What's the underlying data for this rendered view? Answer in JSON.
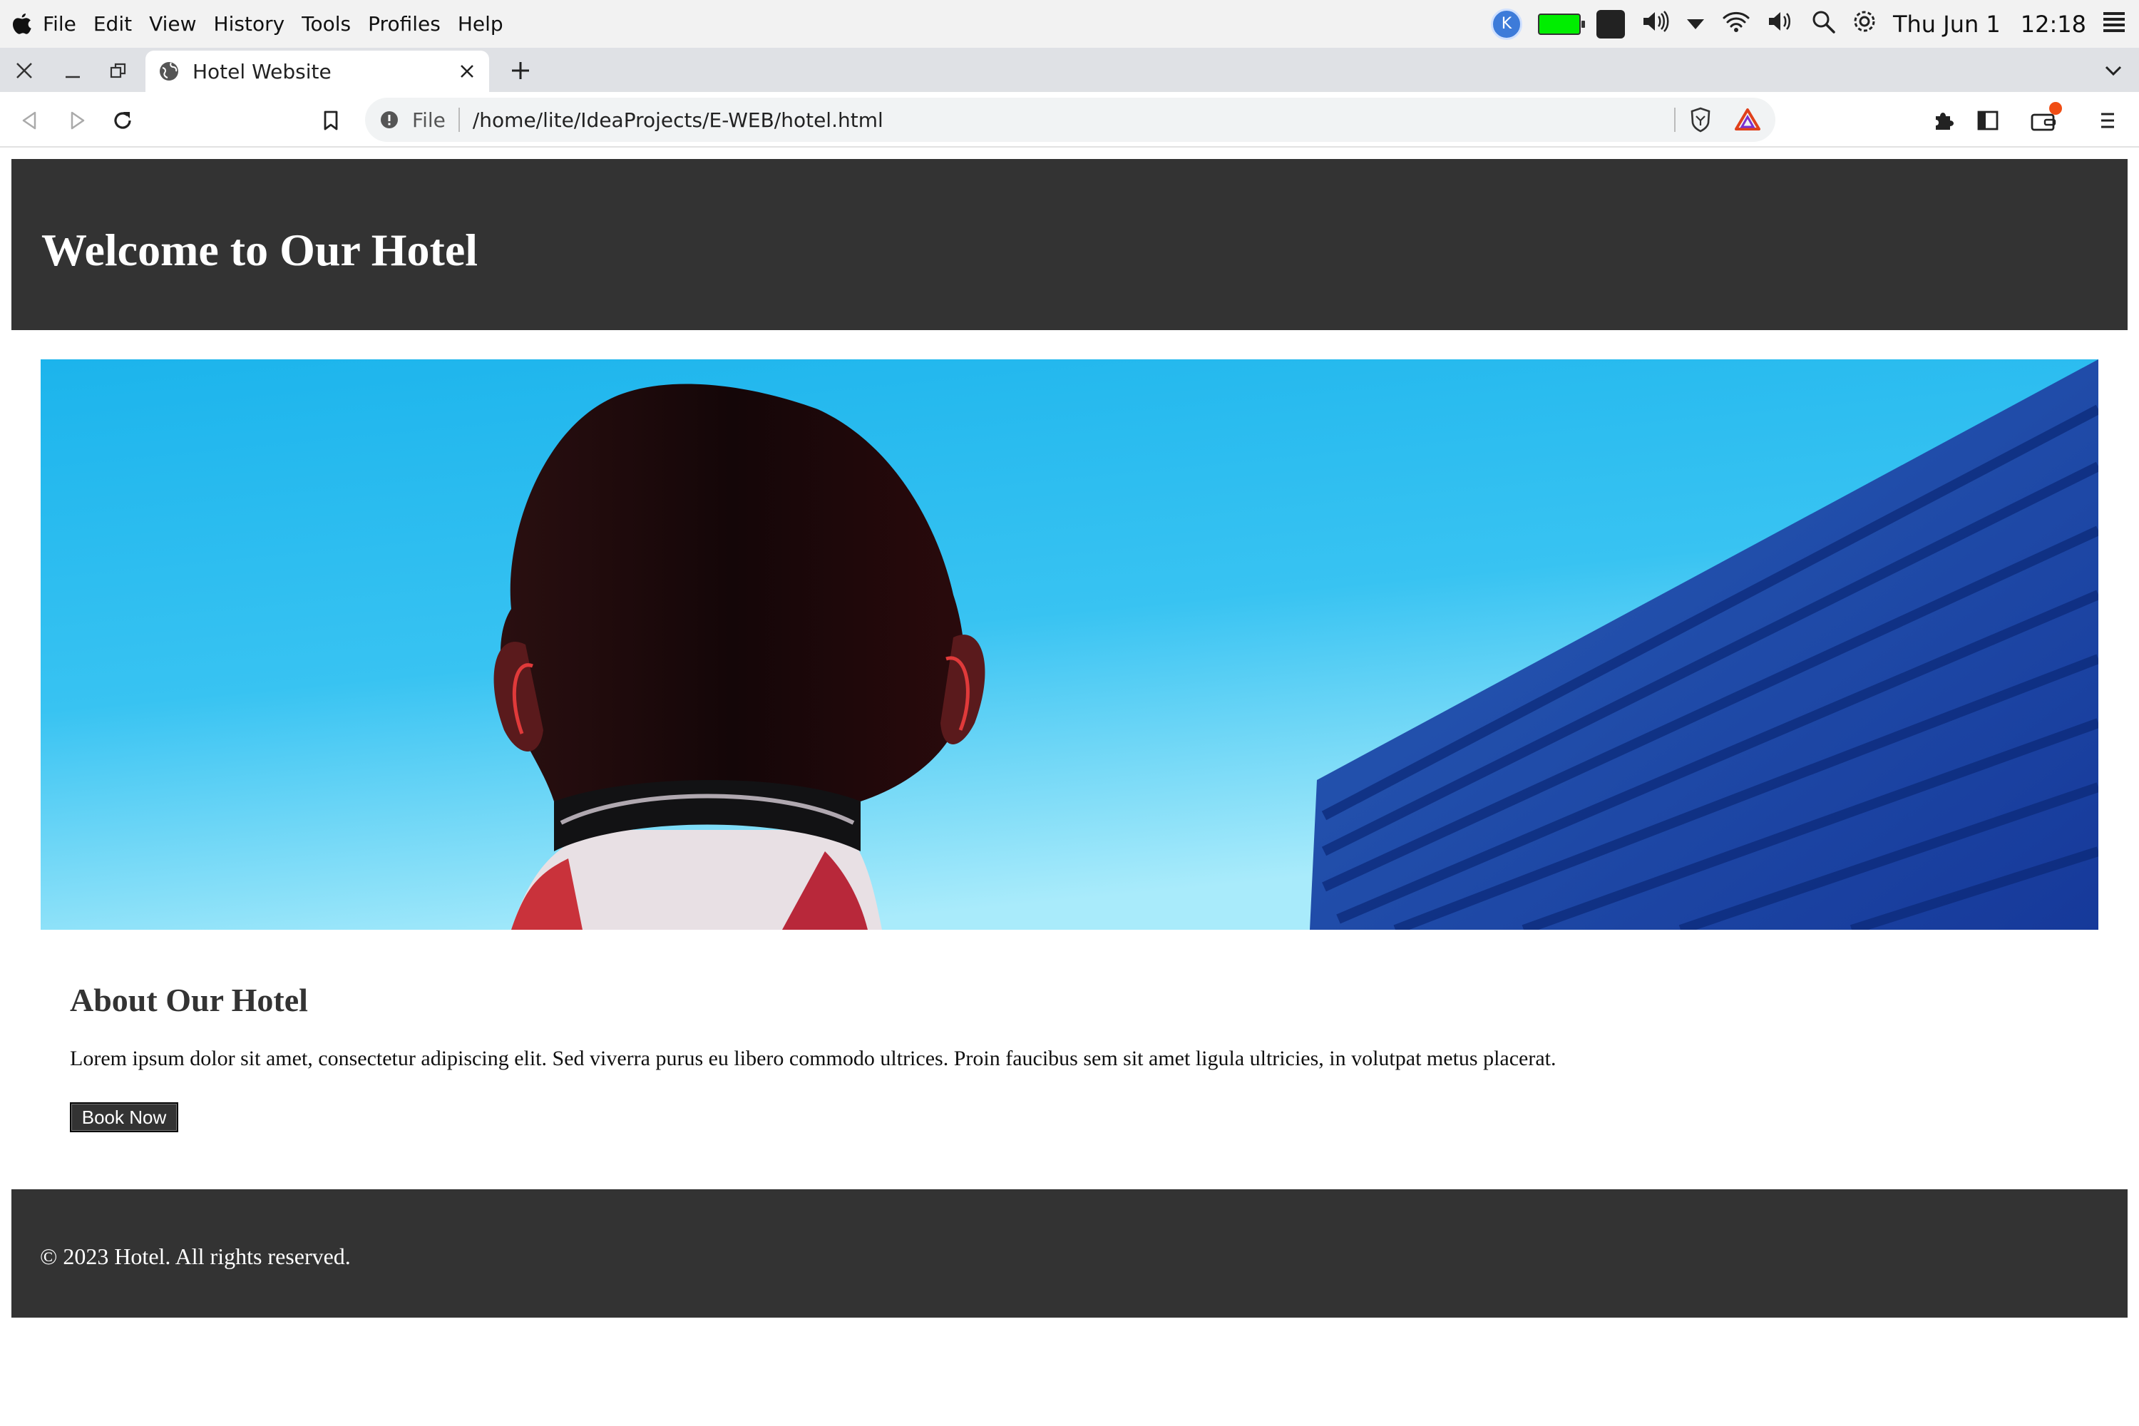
{
  "menubar": {
    "items": [
      "File",
      "Edit",
      "View",
      "History",
      "Tools",
      "Profiles",
      "Help"
    ],
    "date": "Thu Jun 1",
    "time": "12:18"
  },
  "browser": {
    "tab_title": "Hotel Website",
    "url_scheme": "File",
    "url_path": "/home/lite/IdeaProjects/E-WEB/hotel.html"
  },
  "page": {
    "header_title": "Welcome to Our Hotel",
    "about_heading": "About Our Hotel",
    "about_text": "Lorem ipsum dolor sit amet, consectetur adipiscing elit. Sed viverra purus eu libero commodo ultrices. Proin faucibus sem sit amet ligula ultricies, in volutpat metus placerat.",
    "book_button": "Book Now",
    "footer_text": "© 2023 Hotel. All rights reserved."
  },
  "colors": {
    "header_bg": "#333333",
    "footer_bg": "#333333",
    "sky": "#1fb8ee",
    "building": "#1f4ea8",
    "battery": "#00ee00"
  }
}
